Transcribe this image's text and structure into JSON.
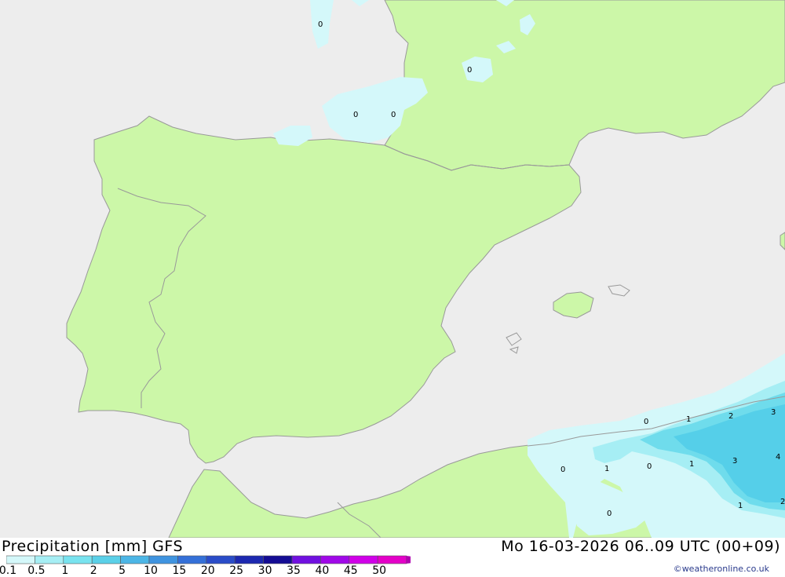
{
  "title": {
    "product": "Precipitation [mm] GFS",
    "datetime": "Mo 16-03-2026 06..09 UTC (00+09)"
  },
  "colors": {
    "sea": "#ededed",
    "land": "#ccf7a8",
    "border": "#999999",
    "precip_lt1": "#d4f8fa",
    "precip_1_2": "#a6eef4",
    "precip_2_5": "#6fdcec",
    "precip_5": "#4fc8e6"
  },
  "legend": {
    "labels": [
      "0.1",
      "0.5",
      "1",
      "2",
      "5",
      "10",
      "15",
      "20",
      "25",
      "30",
      "35",
      "40",
      "45",
      "50"
    ],
    "colors": [
      "#d4f8fa",
      "#a6eef4",
      "#78e3ef",
      "#5ad0e8",
      "#4cb6e6",
      "#3f94e0",
      "#3470d8",
      "#2a4cc8",
      "#1c28b0",
      "#140c94",
      "#7010e0",
      "#a008e8",
      "#d000e8",
      "#e400c8",
      "#b000b0"
    ]
  },
  "map_labels": [
    "0",
    "0",
    "0",
    "0",
    "0",
    "1",
    "2",
    "3",
    "0",
    "1",
    "0",
    "1",
    "3",
    "4",
    "1",
    "2",
    "0"
  ],
  "credit": "©weatheronline.co.uk"
}
